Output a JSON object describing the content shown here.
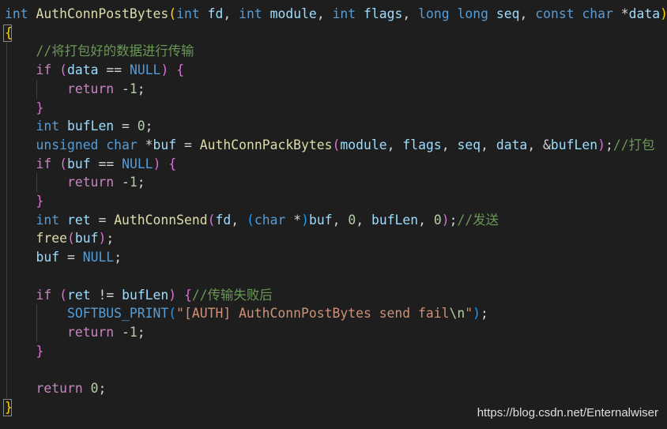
{
  "colors": {
    "background": "#1e1e1e",
    "keyword": "#569cd6",
    "control": "#c586c0",
    "function": "#dcdcaa",
    "variable": "#9cdcfe",
    "number": "#b5cea8",
    "string": "#ce9178",
    "comment": "#6a9955",
    "macro": "#569cd6",
    "plain": "#d4d4d4",
    "brace_outer": "#ffd700",
    "brace_inner": "#da70d6",
    "paren": "#179fff"
  },
  "code": {
    "lines": [
      [
        [
          "int",
          "keyword"
        ],
        [
          " ",
          "plain"
        ],
        [
          "AuthConnPostBytes",
          "function"
        ],
        [
          "(",
          "brace_outer"
        ],
        [
          "int",
          "keyword"
        ],
        [
          " ",
          "plain"
        ],
        [
          "fd",
          "variable"
        ],
        [
          ", ",
          "plain"
        ],
        [
          "int",
          "keyword"
        ],
        [
          " ",
          "plain"
        ],
        [
          "module",
          "variable"
        ],
        [
          ", ",
          "plain"
        ],
        [
          "int",
          "keyword"
        ],
        [
          " ",
          "plain"
        ],
        [
          "flags",
          "variable"
        ],
        [
          ", ",
          "plain"
        ],
        [
          "long",
          "keyword"
        ],
        [
          " ",
          "plain"
        ],
        [
          "long",
          "keyword"
        ],
        [
          " ",
          "plain"
        ],
        [
          "seq",
          "variable"
        ],
        [
          ", ",
          "plain"
        ],
        [
          "const",
          "keyword"
        ],
        [
          " ",
          "plain"
        ],
        [
          "char",
          "keyword"
        ],
        [
          " *",
          "plain"
        ],
        [
          "data",
          "variable"
        ],
        [
          ")",
          "brace_outer"
        ]
      ],
      [
        [
          "{",
          "brace_outer"
        ]
      ],
      [
        [
          "    ",
          "plain"
        ],
        [
          "//将打包好的数据进行传输",
          "comment"
        ]
      ],
      [
        [
          "    ",
          "plain"
        ],
        [
          "if",
          "control"
        ],
        [
          " ",
          "plain"
        ],
        [
          "(",
          "brace_inner"
        ],
        [
          "data",
          "variable"
        ],
        [
          " == ",
          "plain"
        ],
        [
          "NULL",
          "macro"
        ],
        [
          ")",
          "brace_inner"
        ],
        [
          " ",
          "plain"
        ],
        [
          "{",
          "brace_inner"
        ]
      ],
      [
        [
          "        ",
          "plain"
        ],
        [
          "return",
          "control"
        ],
        [
          " -",
          "plain"
        ],
        [
          "1",
          "number"
        ],
        [
          ";",
          "plain"
        ]
      ],
      [
        [
          "    ",
          "plain"
        ],
        [
          "}",
          "brace_inner"
        ]
      ],
      [
        [
          "    ",
          "plain"
        ],
        [
          "int",
          "keyword"
        ],
        [
          " ",
          "plain"
        ],
        [
          "bufLen",
          "variable"
        ],
        [
          " = ",
          "plain"
        ],
        [
          "0",
          "number"
        ],
        [
          ";",
          "plain"
        ]
      ],
      [
        [
          "    ",
          "plain"
        ],
        [
          "unsigned",
          "keyword"
        ],
        [
          " ",
          "plain"
        ],
        [
          "char",
          "keyword"
        ],
        [
          " *",
          "plain"
        ],
        [
          "buf",
          "variable"
        ],
        [
          " = ",
          "plain"
        ],
        [
          "AuthConnPackBytes",
          "function"
        ],
        [
          "(",
          "brace_inner"
        ],
        [
          "module",
          "variable"
        ],
        [
          ", ",
          "plain"
        ],
        [
          "flags",
          "variable"
        ],
        [
          ", ",
          "plain"
        ],
        [
          "seq",
          "variable"
        ],
        [
          ", ",
          "plain"
        ],
        [
          "data",
          "variable"
        ],
        [
          ", &",
          "plain"
        ],
        [
          "bufLen",
          "variable"
        ],
        [
          ")",
          "brace_inner"
        ],
        [
          ";",
          "plain"
        ],
        [
          "//打包",
          "comment"
        ]
      ],
      [
        [
          "    ",
          "plain"
        ],
        [
          "if",
          "control"
        ],
        [
          " ",
          "plain"
        ],
        [
          "(",
          "brace_inner"
        ],
        [
          "buf",
          "variable"
        ],
        [
          " == ",
          "plain"
        ],
        [
          "NULL",
          "macro"
        ],
        [
          ")",
          "brace_inner"
        ],
        [
          " ",
          "plain"
        ],
        [
          "{",
          "brace_inner"
        ]
      ],
      [
        [
          "        ",
          "plain"
        ],
        [
          "return",
          "control"
        ],
        [
          " -",
          "plain"
        ],
        [
          "1",
          "number"
        ],
        [
          ";",
          "plain"
        ]
      ],
      [
        [
          "    ",
          "plain"
        ],
        [
          "}",
          "brace_inner"
        ]
      ],
      [
        [
          "    ",
          "plain"
        ],
        [
          "int",
          "keyword"
        ],
        [
          " ",
          "plain"
        ],
        [
          "ret",
          "variable"
        ],
        [
          " = ",
          "plain"
        ],
        [
          "AuthConnSend",
          "function"
        ],
        [
          "(",
          "brace_inner"
        ],
        [
          "fd",
          "variable"
        ],
        [
          ", ",
          "plain"
        ],
        [
          "(",
          "paren"
        ],
        [
          "char",
          "keyword"
        ],
        [
          " *",
          "plain"
        ],
        [
          ")",
          "paren"
        ],
        [
          "buf",
          "variable"
        ],
        [
          ", ",
          "plain"
        ],
        [
          "0",
          "number"
        ],
        [
          ", ",
          "plain"
        ],
        [
          "bufLen",
          "variable"
        ],
        [
          ", ",
          "plain"
        ],
        [
          "0",
          "number"
        ],
        [
          ")",
          "brace_inner"
        ],
        [
          ";",
          "plain"
        ],
        [
          "//发送",
          "comment"
        ]
      ],
      [
        [
          "    ",
          "plain"
        ],
        [
          "free",
          "function"
        ],
        [
          "(",
          "brace_inner"
        ],
        [
          "buf",
          "variable"
        ],
        [
          ")",
          "brace_inner"
        ],
        [
          ";",
          "plain"
        ]
      ],
      [
        [
          "    ",
          "plain"
        ],
        [
          "buf",
          "variable"
        ],
        [
          " = ",
          "plain"
        ],
        [
          "NULL",
          "macro"
        ],
        [
          ";",
          "plain"
        ]
      ],
      [],
      [
        [
          "    ",
          "plain"
        ],
        [
          "if",
          "control"
        ],
        [
          " ",
          "plain"
        ],
        [
          "(",
          "brace_inner"
        ],
        [
          "ret",
          "variable"
        ],
        [
          " != ",
          "plain"
        ],
        [
          "bufLen",
          "variable"
        ],
        [
          ")",
          "brace_inner"
        ],
        [
          " ",
          "plain"
        ],
        [
          "{",
          "brace_inner"
        ],
        [
          "//传输失败后",
          "comment"
        ]
      ],
      [
        [
          "        ",
          "plain"
        ],
        [
          "SOFTBUS_PRINT",
          "macro"
        ],
        [
          "(",
          "paren"
        ],
        [
          "\"[AUTH] AuthConnPostBytes send fail",
          "string"
        ],
        [
          "\\n",
          "number"
        ],
        [
          "\"",
          "string"
        ],
        [
          ")",
          "paren"
        ],
        [
          ";",
          "plain"
        ]
      ],
      [
        [
          "        ",
          "plain"
        ],
        [
          "return",
          "control"
        ],
        [
          " -",
          "plain"
        ],
        [
          "1",
          "number"
        ],
        [
          ";",
          "plain"
        ]
      ],
      [
        [
          "    ",
          "plain"
        ],
        [
          "}",
          "brace_inner"
        ]
      ],
      [],
      [
        [
          "    ",
          "plain"
        ],
        [
          "return",
          "control"
        ],
        [
          " ",
          "plain"
        ],
        [
          "0",
          "number"
        ],
        [
          ";",
          "plain"
        ]
      ],
      [
        [
          "}",
          "brace_outer"
        ]
      ]
    ]
  },
  "watermark": {
    "text": "https://blog.csdn.net/Enternalwiser"
  }
}
